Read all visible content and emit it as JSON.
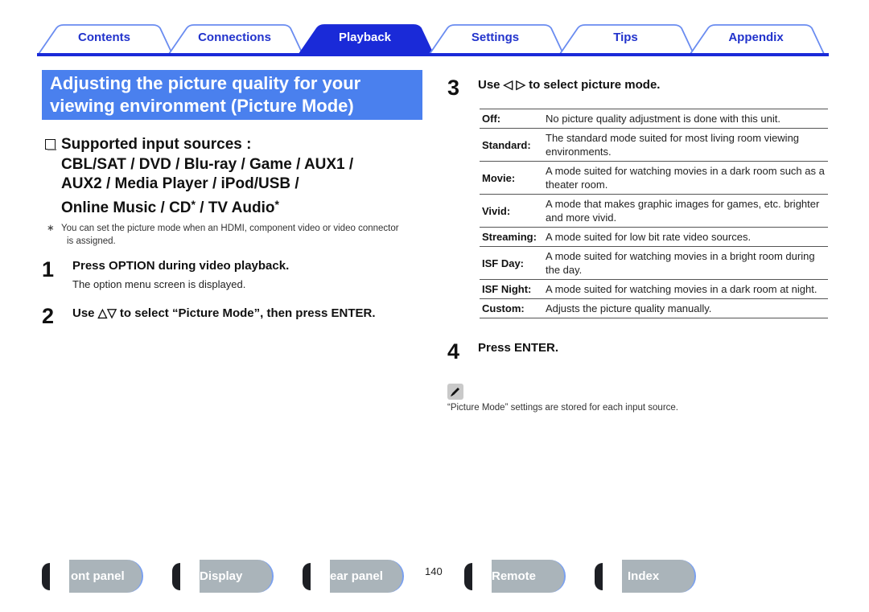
{
  "tabs": [
    {
      "label": "Contents",
      "active": false
    },
    {
      "label": "Connections",
      "active": false
    },
    {
      "label": "Playback",
      "active": true
    },
    {
      "label": "Settings",
      "active": false
    },
    {
      "label": "Tips",
      "active": false
    },
    {
      "label": "Appendix",
      "active": false
    }
  ],
  "colors": {
    "tab_accent": "#1a2ad8",
    "tab_outline": "#6a8cf0",
    "heading_bg": "#4a80ee",
    "nav_button_bg": "#aab4ba"
  },
  "heading": {
    "line1": "Adjusting the picture quality for your",
    "line2": "viewing environment (Picture Mode)"
  },
  "sources": {
    "icon": "checkbox-icon",
    "line1": "Supported input sources :",
    "line2": "CBL/SAT / DVD / Blu-ray / Game / AUX1 /",
    "line3": "AUX2 / Media Player / iPod/USB /",
    "line4_a": "Online Music / CD",
    "line4_b": " / TV Audio",
    "asterisk": "*"
  },
  "footnote": {
    "marker": "∗",
    "text": "You can set the picture mode when an HDMI, component video or video connector is assigned."
  },
  "steps": [
    {
      "number": "1",
      "title": "Press OPTION during video playback.",
      "desc": "The option menu screen is displayed."
    },
    {
      "number": "2",
      "title": "Use △▽ to select “Picture Mode”, then press ENTER.",
      "desc": ""
    },
    {
      "number": "3",
      "title": "Use ◁ ▷ to select picture mode.",
      "desc": ""
    },
    {
      "number": "4",
      "title": "Press ENTER.",
      "desc": ""
    }
  ],
  "modes": [
    {
      "name": "Off:",
      "desc": "No picture quality adjustment is done with this unit."
    },
    {
      "name": "Standard:",
      "desc": "The standard mode suited for most living room viewing environments."
    },
    {
      "name": "Movie:",
      "desc": "A mode suited for watching movies in a dark room such as a theater room."
    },
    {
      "name": "Vivid:",
      "desc": "A mode that makes graphic images for games, etc. brighter and more vivid."
    },
    {
      "name": "Streaming:",
      "desc": "A mode suited for low bit rate video sources."
    },
    {
      "name": "ISF Day:",
      "desc": "A mode suited for watching movies in a bright room during the day."
    },
    {
      "name": "ISF Night:",
      "desc": "A mode suited for watching movies in a dark room at night."
    },
    {
      "name": "Custom:",
      "desc": "Adjusts the picture quality manually."
    }
  ],
  "note": {
    "icon": "pencil-icon",
    "text": "“Picture Mode” settings are stored for each input source."
  },
  "bottom_nav": {
    "buttons": [
      {
        "label": "ont panel"
      },
      {
        "label": "Display"
      },
      {
        "label": "ear panel"
      },
      {
        "label": "Remote"
      },
      {
        "label": "Index"
      }
    ],
    "page_number": "140"
  }
}
